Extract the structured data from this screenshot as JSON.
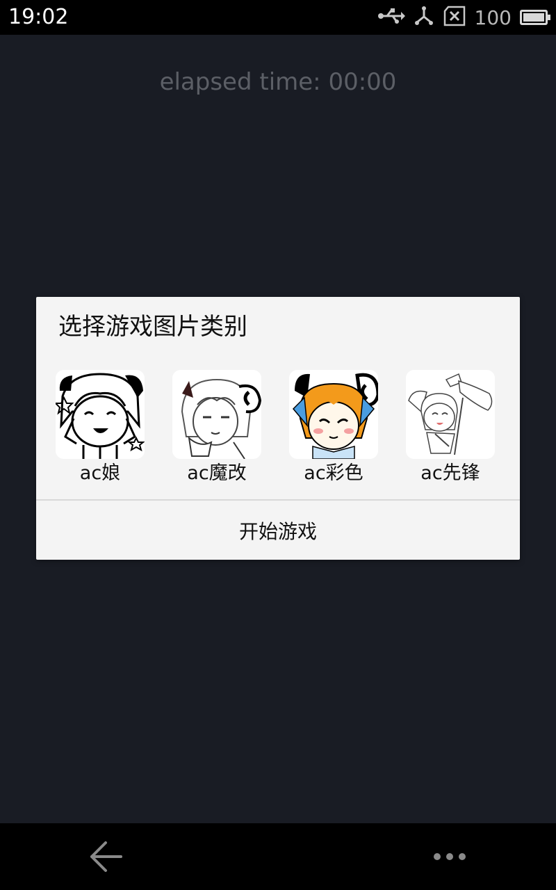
{
  "status_bar": {
    "time": "19:02",
    "battery_level": "100",
    "battery_percent": 100,
    "icons": [
      "usb-icon",
      "usb-debug-icon",
      "no-sim-icon",
      "battery-icon"
    ]
  },
  "timer": {
    "text": "elapsed time: 00:00"
  },
  "dialog": {
    "title": "选择游戏图片类别",
    "options": [
      {
        "label": "ac娘",
        "icon": "ac-niang-thumbnail"
      },
      {
        "label": "ac魔改",
        "icon": "ac-mogai-thumbnail"
      },
      {
        "label": "ac彩色",
        "icon": "ac-caise-thumbnail"
      },
      {
        "label": "ac先锋",
        "icon": "ac-xianfeng-thumbnail"
      }
    ],
    "start_button": "开始游戏"
  },
  "nav_bar": {
    "icons": [
      "back-arrow-icon",
      "more-dots-icon"
    ]
  },
  "colors": {
    "background": "#191c24",
    "dialog_background": "#f4f4f4",
    "timer_text": "#5c5f66",
    "hair_orange": "#f39a1b",
    "ribbon_blue": "#4a9de0"
  }
}
